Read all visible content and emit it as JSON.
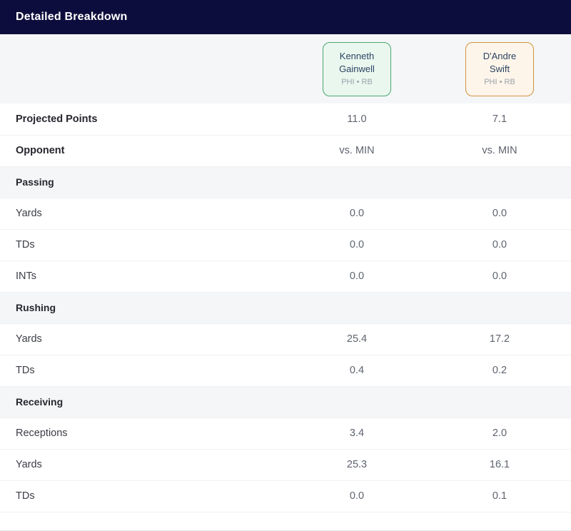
{
  "header": {
    "title": "Detailed Breakdown"
  },
  "players": [
    {
      "name_line1": "Kenneth",
      "name_line2": "Gainwell",
      "meta": "PHI • RB",
      "accent_border": "#4aa871",
      "accent_bg": "#eaf7ef",
      "style": "green"
    },
    {
      "name_line1": "D'Andre",
      "name_line2": "Swift",
      "meta": "PHI • RB",
      "accent_border": "#d3933f",
      "accent_bg": "#fdf5ea",
      "style": "orange"
    }
  ],
  "rows": [
    {
      "kind": "data",
      "label": "Projected Points",
      "bold": true,
      "values": [
        "11.0",
        "7.1"
      ]
    },
    {
      "kind": "data",
      "label": "Opponent",
      "bold": true,
      "values": [
        "vs. MIN",
        "vs. MIN"
      ]
    },
    {
      "kind": "section",
      "label": "Passing"
    },
    {
      "kind": "data",
      "label": "Yards",
      "bold": false,
      "values": [
        "0.0",
        "0.0"
      ]
    },
    {
      "kind": "data",
      "label": "TDs",
      "bold": false,
      "values": [
        "0.0",
        "0.0"
      ]
    },
    {
      "kind": "data",
      "label": "INTs",
      "bold": false,
      "values": [
        "0.0",
        "0.0"
      ]
    },
    {
      "kind": "section",
      "label": "Rushing"
    },
    {
      "kind": "data",
      "label": "Yards",
      "bold": false,
      "values": [
        "25.4",
        "17.2"
      ]
    },
    {
      "kind": "data",
      "label": "TDs",
      "bold": false,
      "values": [
        "0.4",
        "0.2"
      ]
    },
    {
      "kind": "section",
      "label": "Receiving"
    },
    {
      "kind": "data",
      "label": "Receptions",
      "bold": false,
      "values": [
        "3.4",
        "2.0"
      ]
    },
    {
      "kind": "data",
      "label": "Yards",
      "bold": false,
      "values": [
        "25.3",
        "16.1"
      ]
    },
    {
      "kind": "data",
      "label": "TDs",
      "bold": false,
      "values": [
        "0.0",
        "0.1"
      ]
    }
  ],
  "colors": {
    "header_bg": "#0d0d3d",
    "header_text": "#ffffff",
    "section_bg": "#f5f6f8",
    "row_bg": "#ffffff",
    "label_text": "#3b3d45",
    "value_text": "#5d636d",
    "player_name_text": "#2c4461",
    "player_meta_text": "#9aa1ab"
  }
}
